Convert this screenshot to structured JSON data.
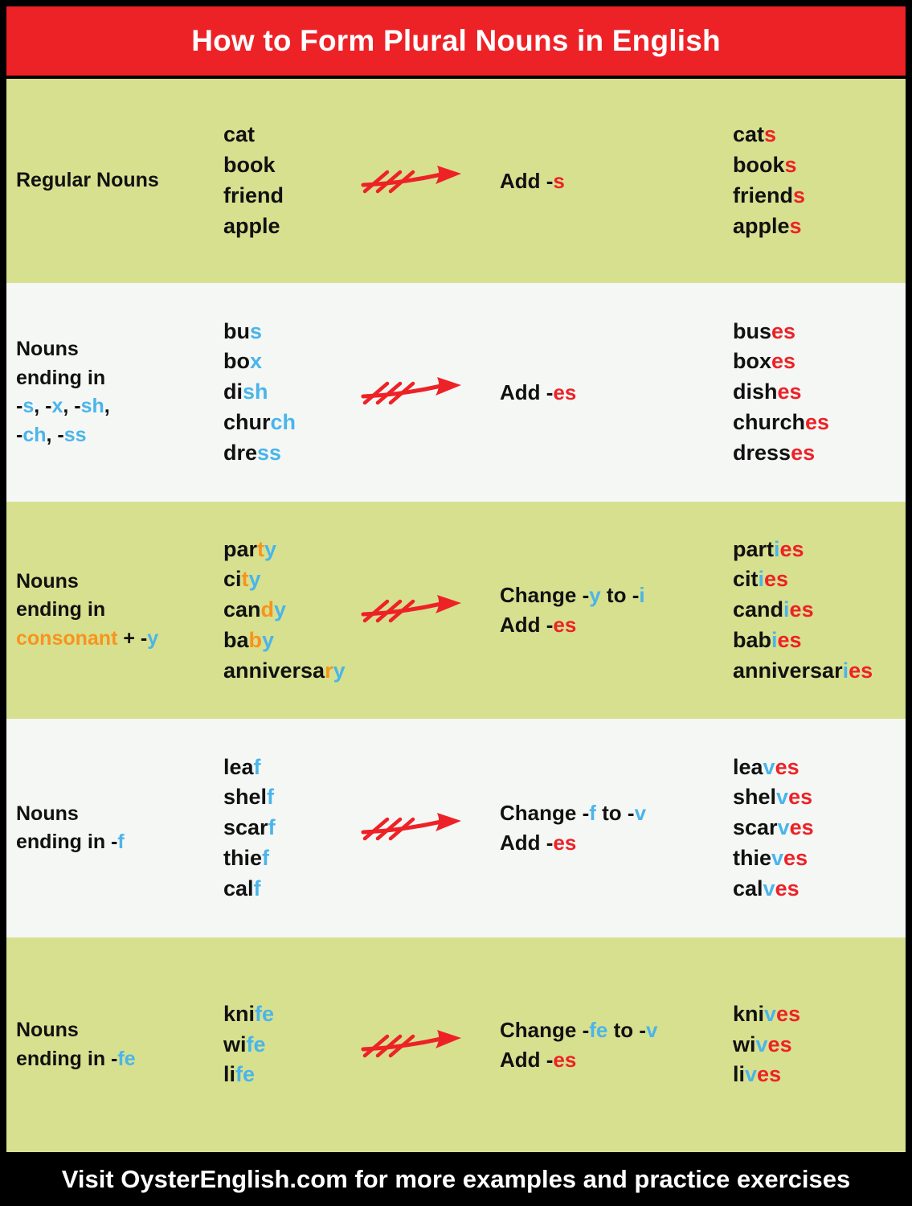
{
  "header": {
    "title": "How to Form Plural Nouns in English",
    "background_color": "#ed2227",
    "text_color": "#ffffff"
  },
  "colors": {
    "red_accent": "#ed2227",
    "blue_accent": "#4ab5ea",
    "orange_accent": "#f7941e",
    "row_green": "#d7e08f",
    "row_white": "#f5f7f5",
    "frame_black": "#000000",
    "text_black": "#111111"
  },
  "icons": {
    "arrow": "red-arrow-icon"
  },
  "rows": [
    {
      "id": "regular-nouns",
      "background": "green",
      "category": {
        "line1_plain": "Regular Nouns"
      },
      "singulars": [
        {
          "base": "cat",
          "suffix": ""
        },
        {
          "base": "book",
          "suffix": ""
        },
        {
          "base": "friend",
          "suffix": ""
        },
        {
          "base": "apple",
          "suffix": ""
        }
      ],
      "rule": {
        "line1_prefix": "Add -",
        "line1_accent": "s",
        "line1_accent_color": "red",
        "line2_prefix": "",
        "line2_accent": "",
        "line2_accent_color": ""
      },
      "plurals": [
        {
          "base": "cat",
          "blue": "",
          "red": "s"
        },
        {
          "base": "book",
          "blue": "",
          "red": "s"
        },
        {
          "base": "friend",
          "blue": "",
          "red": "s"
        },
        {
          "base": "apple",
          "blue": "",
          "red": "s"
        }
      ]
    },
    {
      "id": "nouns-ending-s-x-sh-ch-ss",
      "background": "white",
      "category": {
        "line1_plain": "Nouns",
        "line2_plain": "ending in",
        "line3_parts": "-s, -x, -sh,",
        "line4_parts": "-ch, -ss"
      },
      "singulars": [
        {
          "base": "bu",
          "suffix": "s"
        },
        {
          "base": "bo",
          "suffix": "x"
        },
        {
          "base": "di",
          "suffix": "sh"
        },
        {
          "base": "chur",
          "suffix": "ch"
        },
        {
          "base": "dre",
          "suffix": "ss"
        }
      ],
      "rule": {
        "line1_prefix": "Add -",
        "line1_accent": "es",
        "line1_accent_color": "red",
        "line2_prefix": "",
        "line2_accent": "",
        "line2_accent_color": ""
      },
      "plurals": [
        {
          "base": "bus",
          "blue": "",
          "red": "es"
        },
        {
          "base": "box",
          "blue": "",
          "red": "es"
        },
        {
          "base": "dish",
          "blue": "",
          "red": "es"
        },
        {
          "base": "church",
          "blue": "",
          "red": "es"
        },
        {
          "base": "dress",
          "blue": "",
          "red": "es"
        }
      ]
    },
    {
      "id": "nouns-ending-consonant-y",
      "background": "green",
      "category": {
        "line1_plain": "Nouns",
        "line2_plain": "ending in",
        "line3_orange": "consonant",
        "line3_plain": " + -",
        "line3_blue": "y"
      },
      "singulars": [
        {
          "base": "par",
          "orange": "t",
          "blue": "y"
        },
        {
          "base": "ci",
          "orange": "t",
          "blue": "y"
        },
        {
          "base": "can",
          "orange": "d",
          "blue": "y"
        },
        {
          "base": "ba",
          "orange": "b",
          "blue": "y"
        },
        {
          "base": "anniversa",
          "orange": "r",
          "blue": "y"
        }
      ],
      "rule": {
        "line1_prefix": "Change -",
        "line1_accent": "y",
        "line1_middle": " to -",
        "line1_accent2": "i",
        "line1_accent_color": "blue",
        "line2_prefix": "Add -",
        "line2_accent": "es",
        "line2_accent_color": "red"
      },
      "plurals": [
        {
          "base": "part",
          "blue": "i",
          "red": "es"
        },
        {
          "base": "cit",
          "blue": "i",
          "red": "es"
        },
        {
          "base": "cand",
          "blue": "i",
          "red": "es"
        },
        {
          "base": "bab",
          "blue": "i",
          "red": "es"
        },
        {
          "base": "anniversar",
          "blue": "i",
          "red": "es"
        }
      ]
    },
    {
      "id": "nouns-ending-f",
      "background": "white",
      "category": {
        "line1_plain": "Nouns",
        "line2_plain": "ending in -",
        "line2_blue": "f"
      },
      "singulars": [
        {
          "base": "lea",
          "suffix": "f"
        },
        {
          "base": "shel",
          "suffix": "f"
        },
        {
          "base": "scar",
          "suffix": "f"
        },
        {
          "base": "thie",
          "suffix": "f"
        },
        {
          "base": "cal",
          "suffix": "f"
        }
      ],
      "rule": {
        "line1_prefix": "Change -",
        "line1_accent": "f",
        "line1_middle": " to -",
        "line1_accent2": "v",
        "line1_accent_color": "blue",
        "line2_prefix": "Add -",
        "line2_accent": "es",
        "line2_accent_color": "red"
      },
      "plurals": [
        {
          "base": "lea",
          "blue": "v",
          "red": "es"
        },
        {
          "base": "shel",
          "blue": "v",
          "red": "es"
        },
        {
          "base": "scar",
          "blue": "v",
          "red": "es"
        },
        {
          "base": "thie",
          "blue": "v",
          "red": "es"
        },
        {
          "base": "cal",
          "blue": "v",
          "red": "es"
        }
      ]
    },
    {
      "id": "nouns-ending-fe",
      "background": "green",
      "category": {
        "line1_plain": "Nouns",
        "line2_plain": "ending in -",
        "line2_blue": "fe"
      },
      "singulars": [
        {
          "base": "kni",
          "suffix": "fe"
        },
        {
          "base": "wi",
          "suffix": "fe"
        },
        {
          "base": "li",
          "suffix": "fe"
        }
      ],
      "rule": {
        "line1_prefix": "Change -",
        "line1_accent": "fe",
        "line1_middle": " to -",
        "line1_accent2": "v",
        "line1_accent_color": "blue",
        "line2_prefix": "Add -",
        "line2_accent": "es",
        "line2_accent_color": "red"
      },
      "plurals": [
        {
          "base": "kni",
          "blue": "v",
          "red": "es"
        },
        {
          "base": "wi",
          "blue": "v",
          "red": "es"
        },
        {
          "base": "li",
          "blue": "v",
          "red": "es"
        }
      ]
    }
  ],
  "footer": {
    "text": "Visit OysterEnglish.com for more examples and practice exercises",
    "background_color": "#000000",
    "text_color": "#ffffff"
  }
}
